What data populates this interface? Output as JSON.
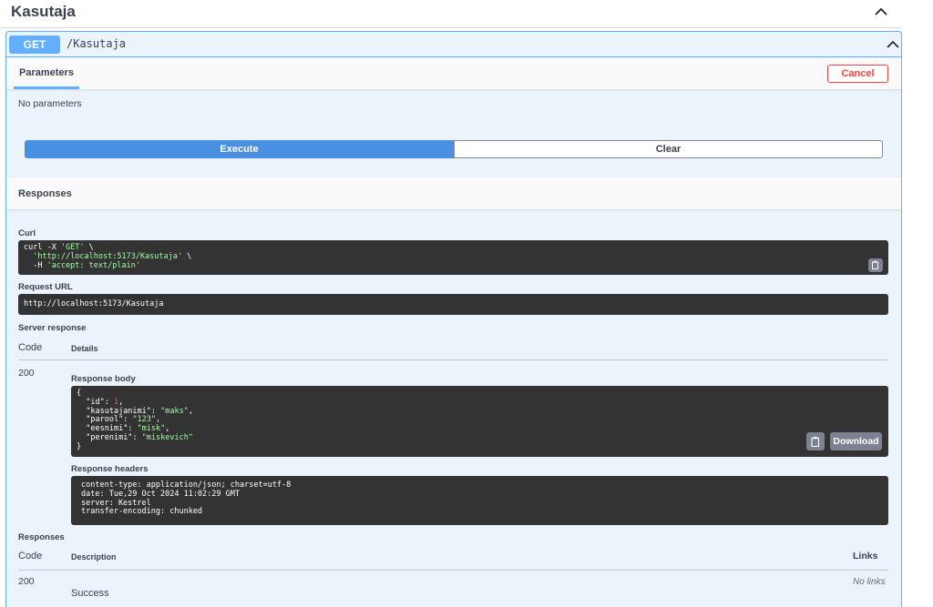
{
  "tag": {
    "title": "Kasutaja"
  },
  "operation": {
    "method": "GET",
    "path": "/Kasutaja"
  },
  "parameters": {
    "tab_label": "Parameters",
    "cancel_label": "Cancel",
    "empty_text": "No parameters",
    "execute_label": "Execute",
    "clear_label": "Clear"
  },
  "responses_header": "Responses",
  "curl": {
    "label": "Curl",
    "line1_prefix": "curl -X ",
    "line1_method": "'GET'",
    "line1_suffix": " \\",
    "line2_url": "'http://localhost:5173/Kasutaja'",
    "line2_suffix": " \\",
    "line3_prefix": "  -H ",
    "line3_header": "'accept: text/plain'"
  },
  "request_url": {
    "label": "Request URL",
    "value": "http://localhost:5173/Kasutaja"
  },
  "server_response": {
    "label": "Server response",
    "code_header": "Code",
    "details_header": "Details",
    "code": "200",
    "body_label": "Response body",
    "body": {
      "open": "{",
      "close": "}",
      "fields": [
        {
          "key": "\"id\"",
          "value": "1",
          "type": "num",
          "comma": ","
        },
        {
          "key": "\"kasutajanimi\"",
          "value": "\"maks\"",
          "type": "str",
          "comma": ","
        },
        {
          "key": "\"parool\"",
          "value": "\"123\"",
          "type": "str",
          "comma": ","
        },
        {
          "key": "\"eesnimi\"",
          "value": "\"misk\"",
          "type": "str",
          "comma": ","
        },
        {
          "key": "\"perenimi\"",
          "value": "\"miskevich\"",
          "type": "str",
          "comma": ""
        }
      ]
    },
    "download_label": "Download",
    "headers_label": "Response headers",
    "headers": [
      "content-type: application/json; charset=utf-8",
      "date: Tue,29 Oct 2024 11:02:29 GMT",
      "server: Kestrel",
      "transfer-encoding: chunked"
    ]
  },
  "responses_table": {
    "label": "Responses",
    "code_header": "Code",
    "description_header": "Description",
    "links_header": "Links",
    "rows": [
      {
        "code": "200",
        "description": "Success",
        "links": "No links"
      }
    ]
  },
  "icons": {
    "collapse": "chevron-up-icon",
    "copy": "clipboard-icon"
  },
  "colors": {
    "get": "#61affe",
    "execute": "#4990e2",
    "cancel": "#f93e3e",
    "code_bg": "#333333",
    "string": "#a2fca2",
    "number": "#d36363"
  }
}
